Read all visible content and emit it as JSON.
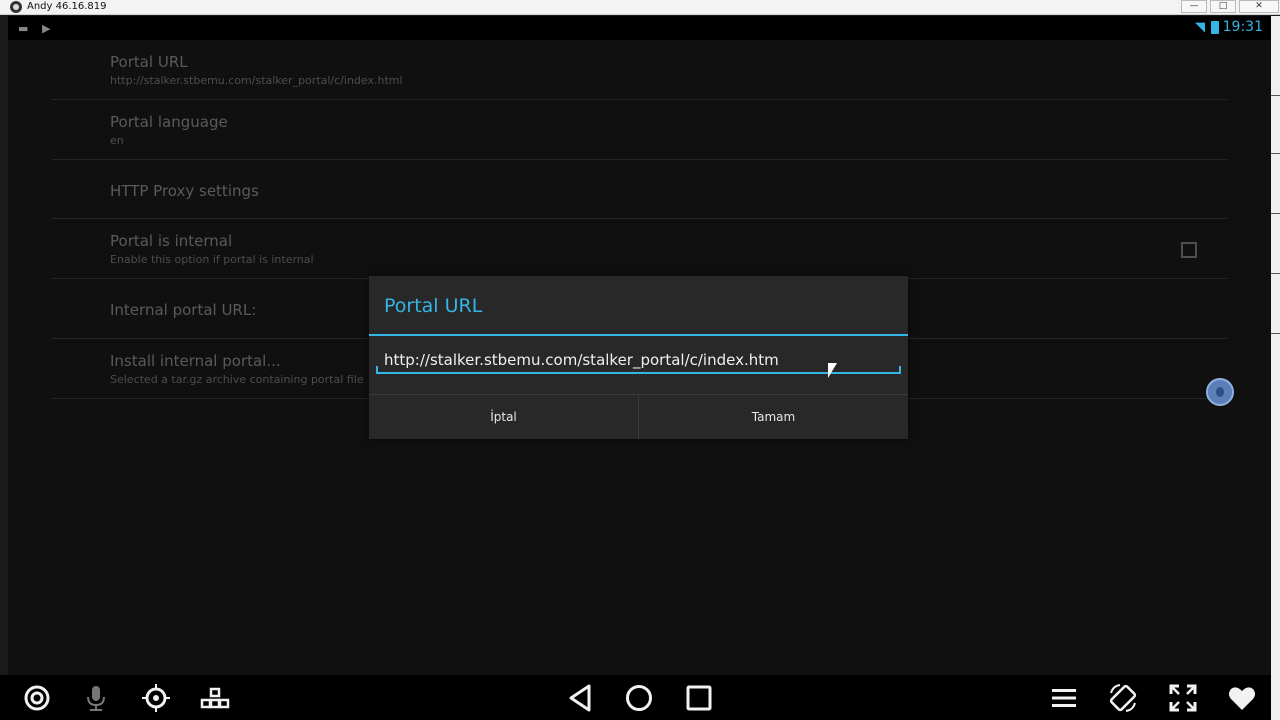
{
  "window": {
    "title": "Andy 46.16.819",
    "min_label": "—",
    "max_label": "□",
    "close_label": "✕"
  },
  "statusbar": {
    "time": "19:31"
  },
  "settings": {
    "portal_url": {
      "title": "Portal URL",
      "summary": "http://stalker.stbemu.com/stalker_portal/c/index.html"
    },
    "portal_language": {
      "title": "Portal language",
      "summary": "en"
    },
    "http_proxy": {
      "title": "HTTP Proxy settings"
    },
    "portal_internal": {
      "title": "Portal is internal",
      "summary": "Enable this option if portal is internal",
      "checked": false
    },
    "internal_portal_url": {
      "title": "Internal portal URL:"
    },
    "install_internal_portal": {
      "title": "Install internal portal...",
      "summary": "Selected a tar.gz archive containing portal file"
    }
  },
  "dialog": {
    "title": "Portal URL",
    "input_value": "http://stalker.stbemu.com/stalker_portal/c/index.htm",
    "cancel_label": "İptal",
    "ok_label": "Tamam"
  },
  "navbar": {
    "icons": [
      "target-icon",
      "microphone-icon",
      "gps-icon",
      "keyboard-map-icon",
      "back-icon",
      "home-icon",
      "recents-icon",
      "menu-icon",
      "rotate-icon",
      "fullscreen-icon",
      "favorite-icon"
    ]
  },
  "colors": {
    "accent": "#33b5e5",
    "dialog_bg": "#282828",
    "screen_bg": "#101010"
  }
}
